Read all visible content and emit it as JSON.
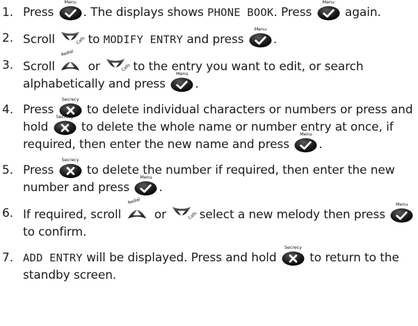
{
  "icons": {
    "ok": "menu-ok-button-icon",
    "clear": "secrecy-clear-button-icon",
    "up": "redial-up-button-icon",
    "down": "calls-down-button-icon"
  },
  "btn_labels": {
    "menu": "Menu",
    "secrecy": "Secrecy",
    "redial": "Redial",
    "calls": "Calls"
  },
  "steps": [
    {
      "num": "1.",
      "t1": "Press ",
      "t2": ". The displays shows ",
      "lcd1": "PHONE BOOK",
      "t3": ". Press ",
      "t4": " again."
    },
    {
      "num": "2.",
      "t1": "Scroll ",
      "t2": " to ",
      "lcd1": "MODIFY ENTRY",
      "t3": " and press ",
      "t4": "."
    },
    {
      "num": "3.",
      "t1": "Scroll ",
      "t2": " or ",
      "t3": " to the entry you want to edit, or search alphabetically and press ",
      "t4": "."
    },
    {
      "num": "4.",
      "t1": "Press ",
      "t2": " to delete individual characters or numbers or press and hold ",
      "t3": " to delete the whole name or number entry at once, if required, then enter the new name and press ",
      "t4": "."
    },
    {
      "num": "5.",
      "t1": "Press ",
      "t2": " to delete the number if required, then enter the new number and press ",
      "t3": "."
    },
    {
      "num": "6.",
      "t1": "If required, scroll ",
      "t2": " or ",
      "t3": " select a new melody then press ",
      "t4": " to confirm."
    },
    {
      "num": "7.",
      "lcd1": "ADD ENTRY",
      "t1": " will be displayed. Press and hold ",
      "t2": " to return to the standby screen."
    }
  ]
}
